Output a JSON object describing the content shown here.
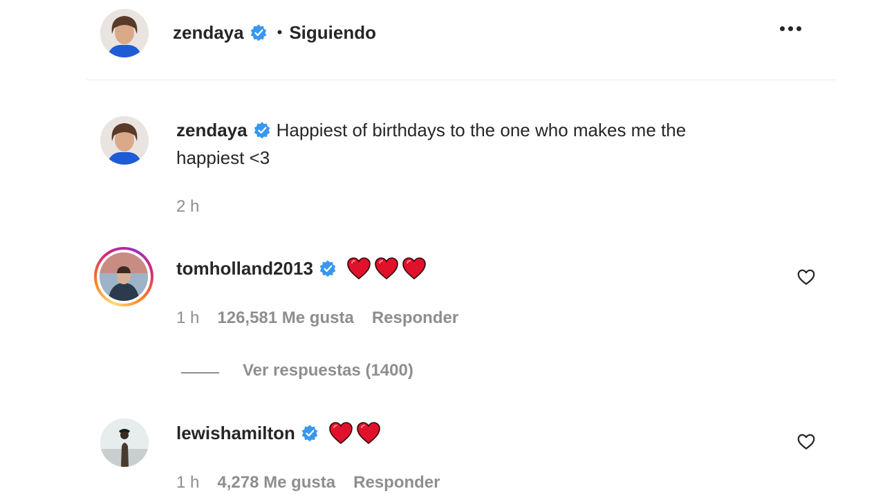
{
  "header": {
    "username": "zendaya",
    "separator": "•",
    "follow_status": "Siguiendo"
  },
  "caption": {
    "username": "zendaya",
    "text_line1": "Happiest of birthdays to the one who makes me the",
    "text_line2": "happiest <3",
    "time": "2 h"
  },
  "comments": [
    {
      "username": "tomholland2013",
      "hearts": 3,
      "time": "1 h",
      "likes": "126,581 Me gusta",
      "reply_label": "Responder",
      "view_replies": "Ver respuestas (1400)"
    },
    {
      "username": "lewishamilton",
      "hearts": 2,
      "time": "1 h",
      "likes": "4,278 Me gusta",
      "reply_label": "Responder"
    }
  ],
  "colors": {
    "verified": "#3897f0",
    "heart_emoji": "#e0112b",
    "meta_text": "#8e8e8e",
    "text": "#262626"
  },
  "icons": {
    "verified": "verified-badge-icon",
    "more": "more-options-icon",
    "like": "heart-outline-icon",
    "emoji": "red-heart-emoji"
  }
}
